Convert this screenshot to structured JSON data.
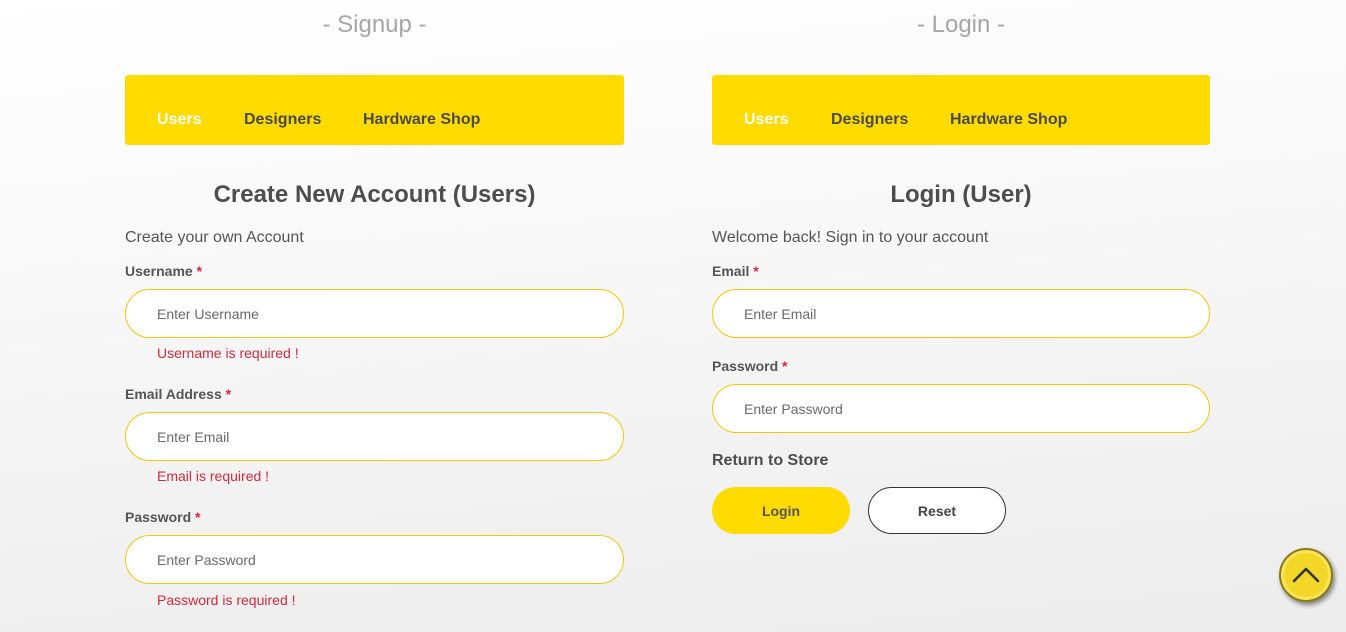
{
  "signup": {
    "section_title": "- Signup -",
    "tabs": [
      {
        "label": "Users",
        "active": true
      },
      {
        "label": "Designers",
        "active": false
      },
      {
        "label": "Hardware Shop",
        "active": false
      }
    ],
    "form_title": "Create New Account (Users)",
    "subtitle": "Create your own Account",
    "fields": [
      {
        "label": "Username",
        "required_mark": "*",
        "placeholder": "Enter Username",
        "value": "",
        "error": "Username is required !"
      },
      {
        "label": "Email Address",
        "required_mark": "*",
        "placeholder": "Enter Email",
        "value": "",
        "error": "Email is required !"
      },
      {
        "label": "Password",
        "required_mark": "*",
        "placeholder": "Enter Password",
        "value": "",
        "error": "Password is required !"
      }
    ]
  },
  "login": {
    "section_title": "- Login -",
    "tabs": [
      {
        "label": "Users",
        "active": true
      },
      {
        "label": "Designers",
        "active": false
      },
      {
        "label": "Hardware Shop",
        "active": false
      }
    ],
    "form_title": "Login (User)",
    "subtitle": "Welcome back! Sign in to your account",
    "fields": [
      {
        "label": "Email",
        "required_mark": "*",
        "placeholder": "Enter Email",
        "value": ""
      },
      {
        "label": "Password",
        "required_mark": "*",
        "placeholder": "Enter Password",
        "value": ""
      }
    ],
    "return_link": "Return to Store",
    "login_button": "Login",
    "reset_button": "Reset"
  },
  "scroll_top": {
    "icon": "chevron-up-icon"
  },
  "colors": {
    "accent": "#ffdb00",
    "error": "#d32a3c",
    "input_border": "#f2c70e",
    "active_tab_text": "#ffffff"
  }
}
